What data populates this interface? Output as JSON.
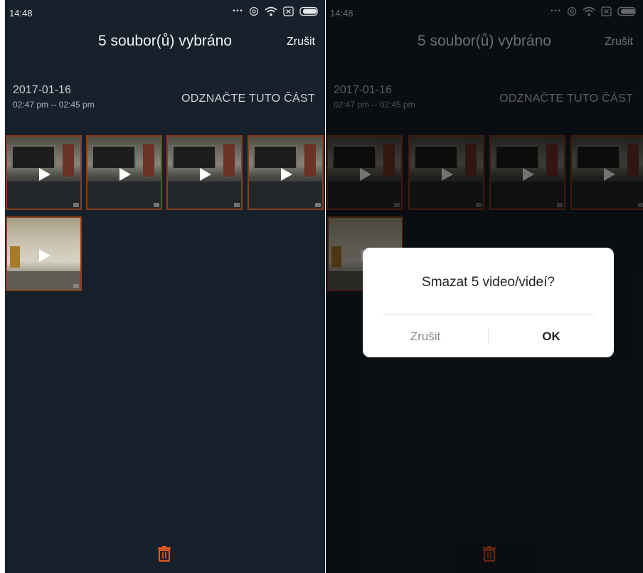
{
  "status": {
    "time": "14:48",
    "icons": [
      "dots-icon",
      "sync-icon",
      "wifi-icon",
      "sim-icon",
      "battery-icon"
    ]
  },
  "header": {
    "title": "5 soubor(ů) vybráno",
    "cancel": "Zrušit"
  },
  "section": {
    "date": "2017-01-16",
    "time_range": "02:47 pm -- 02:45 pm",
    "deselect": "ODZNAČTE TUTO ČÁST"
  },
  "thumbnails": {
    "count": 5,
    "icon": "play-icon"
  },
  "toolbar": {
    "icon": "trash-icon"
  },
  "dialog": {
    "message": "Smazat 5 video/videí?",
    "cancel": "Zrušit",
    "ok": "OK"
  },
  "colors": {
    "background": "#17212b",
    "accent": "#e2561f",
    "selection_border": "#8c3d1c"
  }
}
